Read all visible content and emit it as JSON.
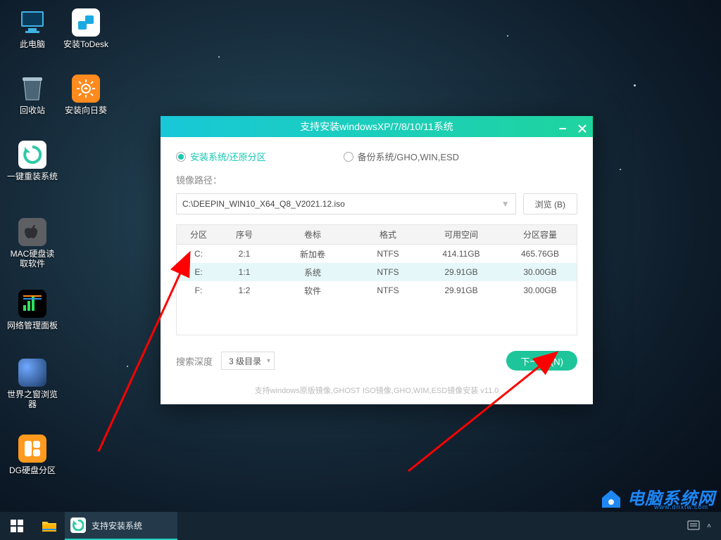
{
  "desktop_icons": {
    "col1": [
      {
        "label": "此电脑"
      },
      {
        "label": "回收站"
      },
      {
        "label": "一键重装系统"
      },
      {
        "label": "MAC硬盘读\n取软件"
      },
      {
        "label": "网络管理面板"
      },
      {
        "label": "世界之窗浏览\n器"
      },
      {
        "label": "DG硬盘分区"
      }
    ],
    "col2": [
      {
        "label": "安装ToDesk"
      },
      {
        "label": "安装向日葵"
      }
    ]
  },
  "dialog": {
    "title": "支持安装windowsXP/7/8/10/11系统",
    "radio_install": "安装系统/还原分区",
    "radio_backup": "备份系统/GHO,WIN,ESD",
    "image_path_label": "镜像路径：",
    "image_path_value": "C:\\DEEPIN_WIN10_X64_Q8_V2021.12.iso",
    "browse": "浏览 (B)",
    "table_headers": {
      "c1": "分区",
      "c2": "序号",
      "c3": "卷标",
      "c4": "格式",
      "c5": "可用空间",
      "c6": "分区容量"
    },
    "rows": [
      {
        "c1": "C:",
        "c2": "2:1",
        "c3": "新加卷",
        "c4": "NTFS",
        "c5": "414.11GB",
        "c6": "465.76GB"
      },
      {
        "c1": "E:",
        "c2": "1:1",
        "c3": "系统",
        "c4": "NTFS",
        "c5": "29.91GB",
        "c6": "30.00GB"
      },
      {
        "c1": "F:",
        "c2": "1:2",
        "c3": "软件",
        "c4": "NTFS",
        "c5": "29.91GB",
        "c6": "30.00GB"
      }
    ],
    "search_depth_label": "搜索深度",
    "search_depth_value": "3 级目录",
    "next": "下一步 (N)",
    "footer": "支持windows原版镜像,GHOST ISO镜像,GHO,WIM,ESD镜像安装 v11.0"
  },
  "taskbar": {
    "app": "支持安装系统"
  },
  "watermark": {
    "title": "电脑系统网",
    "sub": "www.dnxtw.com"
  }
}
